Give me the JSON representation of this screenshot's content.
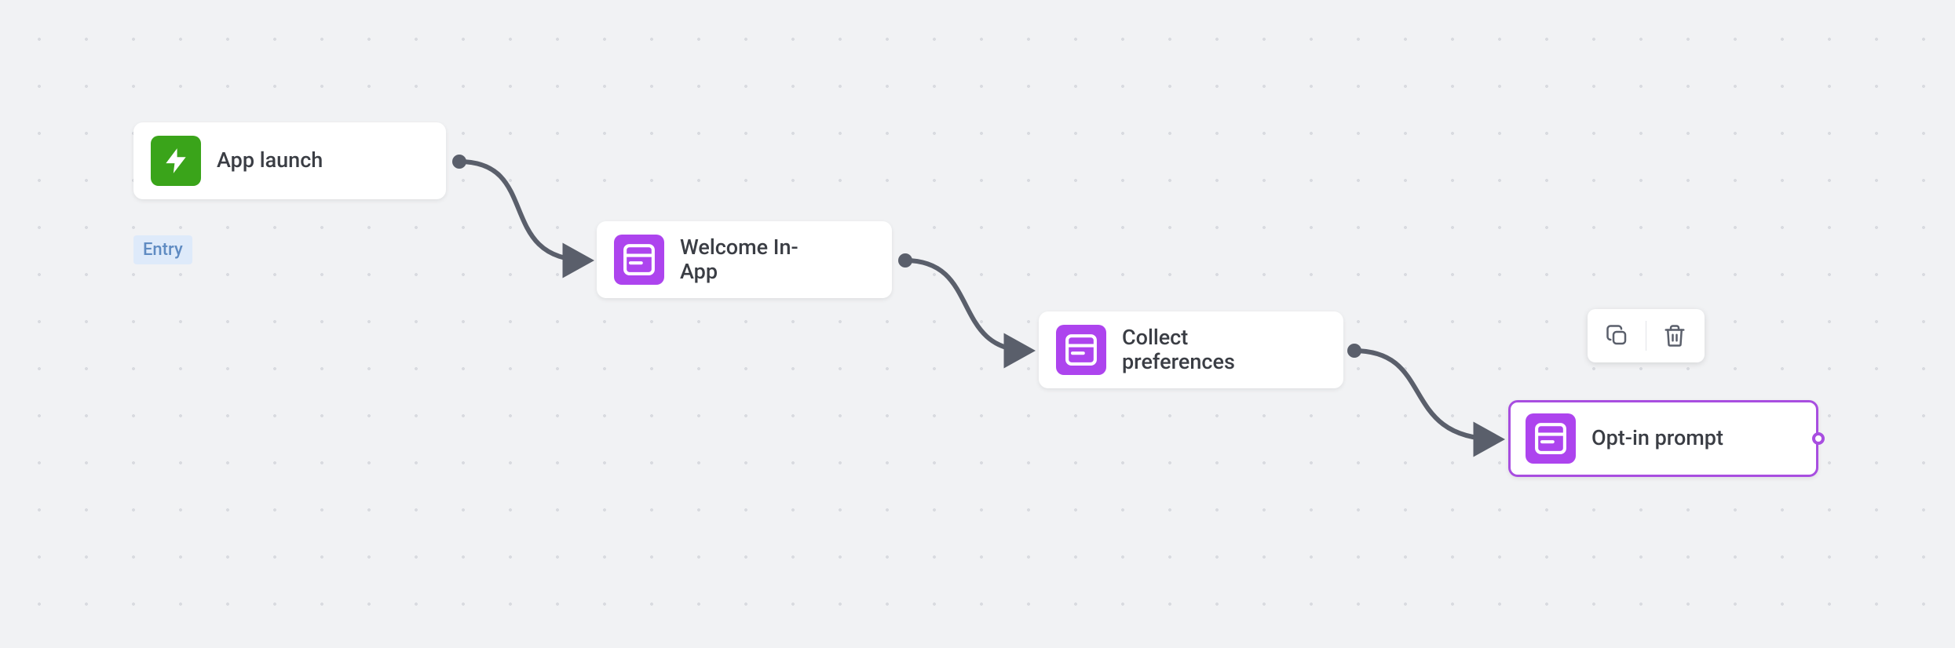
{
  "nodes": {
    "entry": {
      "label": "App launch",
      "tag": "Entry",
      "icon_name": "bolt-icon",
      "icon_color": "green"
    },
    "welcome": {
      "label": "Welcome In-\nApp",
      "icon_name": "window-icon",
      "icon_color": "purple"
    },
    "collect": {
      "label": "Collect\npreferences",
      "icon_name": "window-icon",
      "icon_color": "purple"
    },
    "optin": {
      "label": "Opt-in prompt",
      "icon_name": "window-icon",
      "icon_color": "purple",
      "selected": true
    }
  },
  "toolbar": {
    "copy_label": "Duplicate",
    "delete_label": "Delete"
  }
}
